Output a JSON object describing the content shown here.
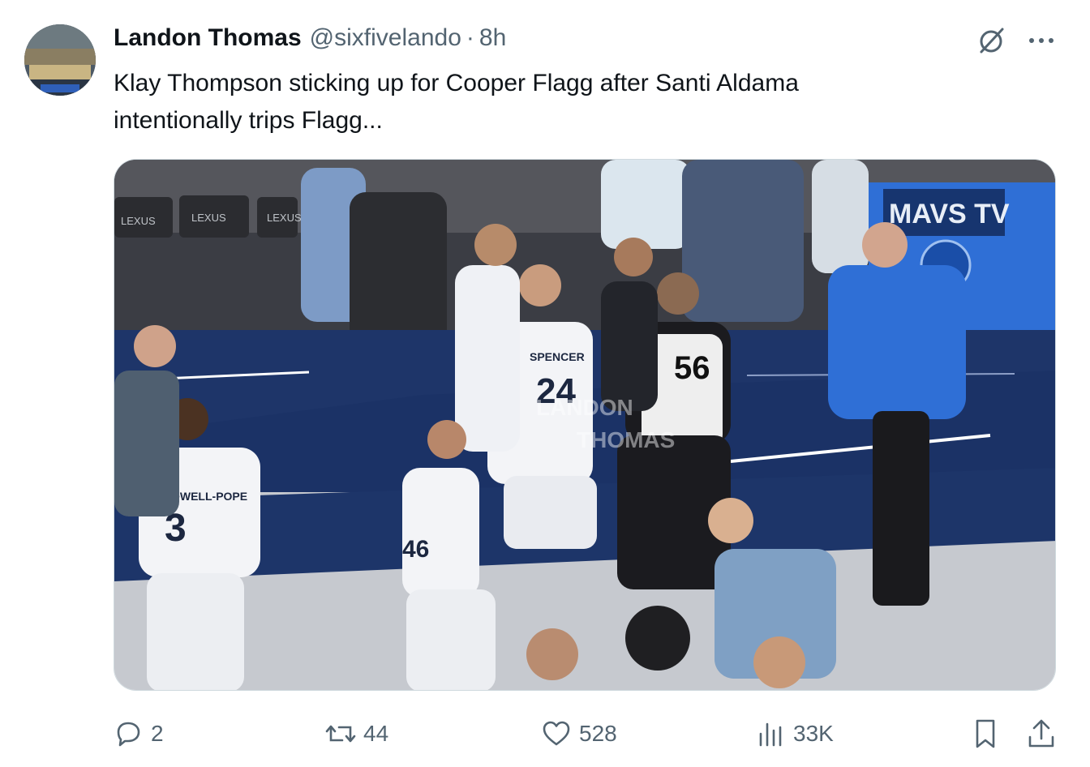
{
  "tweet": {
    "author_name": "Landon Thomas",
    "handle": "@sixfivelando",
    "separator": "·",
    "time": "8h",
    "text": "Klay Thompson sticking up for Cooper Flagg after Santi Aldama intentionally trips Flagg..."
  },
  "media": {
    "watermark_line1": "LANDON",
    "watermark_line2": "THOMAS",
    "banner_text": "MAVS TV",
    "jersey_numbers": [
      "3",
      "24",
      "56",
      "46"
    ],
    "jersey_names": [
      "CALDWELL-POPE",
      "SPENCER"
    ],
    "sponsor": "LEXUS"
  },
  "actions": {
    "replies": "2",
    "reposts": "44",
    "likes": "528",
    "views": "33K"
  },
  "icons": {
    "reply": "reply-icon",
    "repost": "repost-icon",
    "like": "heart-icon",
    "views": "views-icon",
    "bookmark": "bookmark-icon",
    "share": "share-icon",
    "grok": "grok-icon",
    "more": "more-icon"
  },
  "colors": {
    "text_primary": "#0f1419",
    "text_secondary": "#536471",
    "court_blue": "#1e3569",
    "mavs_blue": "#2f6fd6"
  }
}
